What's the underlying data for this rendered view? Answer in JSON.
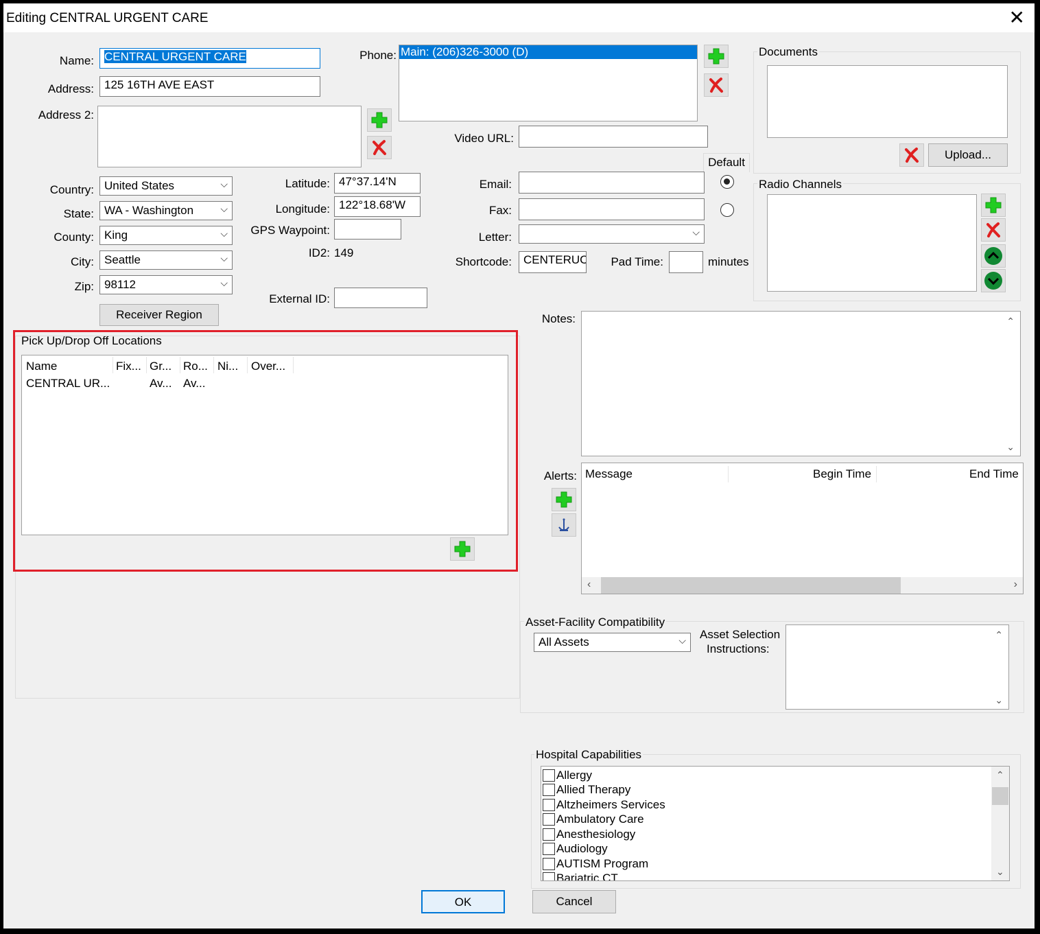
{
  "window": {
    "title": "Editing CENTRAL URGENT CARE"
  },
  "labels": {
    "name": "Name:",
    "address": "Address:",
    "address2": "Address 2:",
    "country": "Country:",
    "state": "State:",
    "county": "County:",
    "city": "City:",
    "zip": "Zip:",
    "latitude": "Latitude:",
    "longitude": "Longitude:",
    "gps": "GPS Waypoint:",
    "id2": "ID2:",
    "external_id": "External ID:",
    "phone": "Phone:",
    "video_url": "Video URL:",
    "default": "Default",
    "email": "Email:",
    "fax": "Fax:",
    "letter": "Letter:",
    "shortcode": "Shortcode:",
    "pad_time": "Pad Time:",
    "minutes": "minutes",
    "notes": "Notes:",
    "alerts": "Alerts:",
    "asset_selection": "Asset Selection",
    "instructions": "Instructions:"
  },
  "fields": {
    "name": "CENTRAL URGENT CARE",
    "address": "125 16TH AVE EAST",
    "address2": "",
    "country": "United States",
    "state": "WA - Washington",
    "county": "King",
    "city": "Seattle",
    "zip": "98112",
    "latitude": "47°37.14'N",
    "longitude": "122°18.68'W",
    "gps": "",
    "id2": "149",
    "external_id": "",
    "video_url": "",
    "email": "",
    "fax": "",
    "letter": "",
    "shortcode": "CENTERUC",
    "pad_time": "",
    "asset_compat": "All Assets"
  },
  "phone_list": [
    "Main: (206)326-3000 (D)"
  ],
  "buttons": {
    "receiver_region": "Receiver Region",
    "upload": "Upload...",
    "ok": "OK",
    "cancel": "Cancel"
  },
  "groups": {
    "documents": "Documents",
    "radio_channels": "Radio Channels",
    "pickup": "Pick Up/Drop Off Locations",
    "asset_facility": "Asset-Facility Compatibility",
    "hospital_caps": "Hospital Capabilities"
  },
  "pickup_table": {
    "columns": [
      "Name",
      "Fix...",
      "Gr...",
      "Ro...",
      "Ni...",
      "Over..."
    ],
    "rows": [
      [
        "CENTRAL UR...",
        "",
        "Av...",
        "Av...",
        "",
        ""
      ]
    ]
  },
  "alerts_table": {
    "columns": [
      "Message",
      "Begin Time",
      "End Time"
    ]
  },
  "capabilities": [
    "Allergy",
    "Allied Therapy",
    "Altzheimers Services",
    "Ambulatory Care",
    "Anesthesiology",
    "Audiology",
    "AUTISM Program",
    "Bariatric CT"
  ],
  "colors": {
    "selection": "#0078d7",
    "highlight": "#e0202a",
    "add_green": "#22cc22",
    "delete_red": "#e02020",
    "nav_green": "#118833"
  },
  "icons": {
    "add": "green-plus-icon",
    "delete": "red-x-icon",
    "up": "green-up-arrow-icon",
    "down": "green-down-arrow-icon",
    "anchor": "anchor-icon",
    "close": "close-icon"
  }
}
